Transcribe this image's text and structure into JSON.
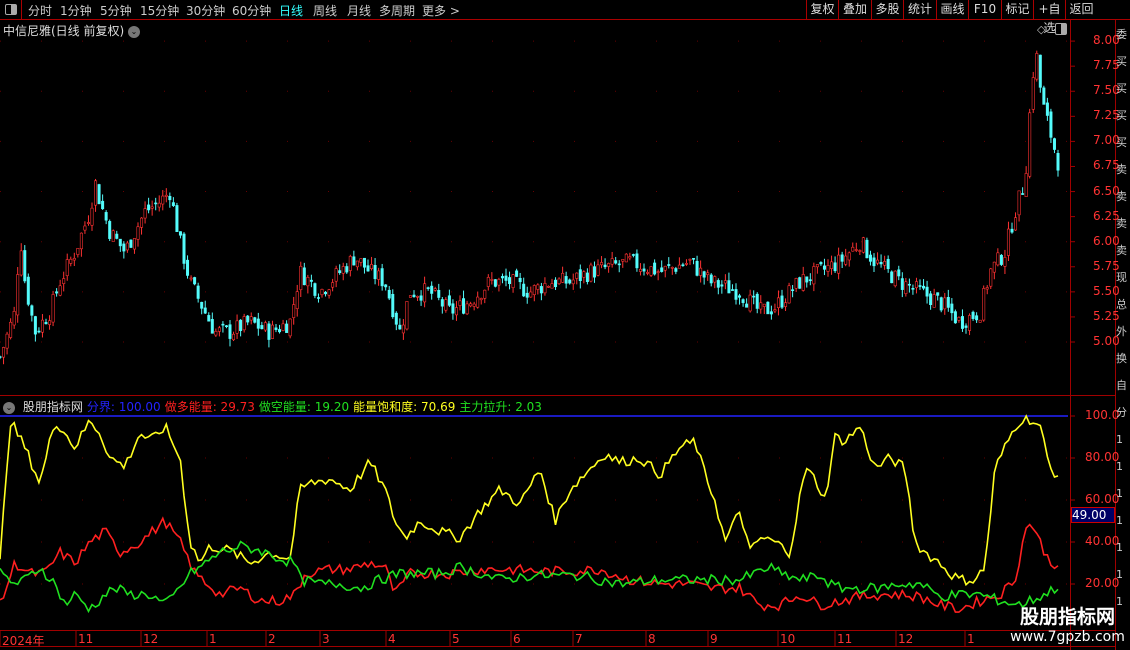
{
  "toolbar": {
    "periods": [
      "分时",
      "1分钟",
      "5分钟",
      "15分钟",
      "30分钟",
      "60分钟",
      "日线",
      "周线",
      "月线",
      "多周期",
      "更多 >"
    ],
    "active": "日线",
    "right_buttons": [
      "复权",
      "叠加",
      "多股",
      "统计",
      "画线",
      "F10",
      "标记",
      "+自选",
      "返回"
    ]
  },
  "chart_title": "中信尼雅(日线 前复权)",
  "indicator": {
    "name": "股朋指标网",
    "items": [
      {
        "label": "分界: 100.00",
        "color": "#2323ff"
      },
      {
        "label": "做多能量: 29.73",
        "color": "#ff2020"
      },
      {
        "label": "做空能量: 19.20",
        "color": "#20e020"
      },
      {
        "label": "能量饱和度: 70.69",
        "color": "#ffff20"
      },
      {
        "label": "主力拉升: 2.03",
        "color": "#20e020"
      }
    ],
    "cursor_value": "49.00"
  },
  "price_axis": [
    "8.00",
    "7.75",
    "7.50",
    "7.25",
    "7.00",
    "6.75",
    "6.50",
    "6.25",
    "6.00",
    "5.75",
    "5.50",
    "5.25",
    "5.00"
  ],
  "ind_axis": [
    "100.0",
    "80.00",
    "60.00",
    "40.00",
    "20.00"
  ],
  "date_axis": [
    "2024年",
    "11",
    "12",
    "1",
    "2",
    "3",
    "4",
    "5",
    "6",
    "7",
    "8",
    "9",
    "10",
    "11",
    "12",
    "1"
  ],
  "watermark": {
    "line1": "股朋指标网",
    "line2": "www.7gpzb.com"
  },
  "right_column_text": [
    "委",
    "买",
    "买",
    "买",
    "买",
    "卖",
    "卖",
    "卖",
    "卖",
    "现",
    "总",
    "外",
    "换",
    "自",
    "分",
    "1",
    "1",
    "1",
    "1",
    "1",
    "1",
    "1"
  ],
  "colors": {
    "up": "#ff3232",
    "down": "#54fcfc",
    "grid": "#a00000",
    "boundary": "#2323ff",
    "long": "#ff2020",
    "short": "#20e020",
    "saturation": "#ffff20"
  },
  "chart_data": {
    "type": "line",
    "t_range": [
      0,
      212
    ],
    "price": [
      [
        0,
        4.85
      ],
      [
        3,
        5.3
      ],
      [
        4,
        6.1
      ],
      [
        5,
        5.6
      ],
      [
        7,
        5.1
      ],
      [
        10,
        5.3
      ],
      [
        12,
        5.6
      ],
      [
        15,
        5.9
      ],
      [
        18,
        6.3
      ],
      [
        19,
        6.6
      ],
      [
        20,
        6.4
      ],
      [
        22,
        6.1
      ],
      [
        25,
        5.9
      ],
      [
        27,
        6.1
      ],
      [
        29,
        6.3
      ],
      [
        32,
        6.4
      ],
      [
        34,
        6.5
      ],
      [
        36,
        6.0
      ],
      [
        38,
        5.6
      ],
      [
        40,
        5.4
      ],
      [
        43,
        5.1
      ],
      [
        46,
        5.1
      ],
      [
        50,
        5.2
      ],
      [
        54,
        5.1
      ],
      [
        58,
        5.2
      ],
      [
        60,
        5.7
      ],
      [
        64,
        5.5
      ],
      [
        68,
        5.7
      ],
      [
        71,
        5.85
      ],
      [
        74,
        5.7
      ],
      [
        77,
        5.6
      ],
      [
        80,
        5.1
      ],
      [
        82,
        5.5
      ],
      [
        86,
        5.5
      ],
      [
        90,
        5.3
      ],
      [
        94,
        5.4
      ],
      [
        98,
        5.6
      ],
      [
        102,
        5.6
      ],
      [
        106,
        5.5
      ],
      [
        110,
        5.6
      ],
      [
        114,
        5.6
      ],
      [
        118,
        5.7
      ],
      [
        122,
        5.75
      ],
      [
        126,
        5.8
      ],
      [
        132,
        5.7
      ],
      [
        138,
        5.8
      ],
      [
        142,
        5.6
      ],
      [
        148,
        5.5
      ],
      [
        152,
        5.3
      ],
      [
        155,
        5.35
      ],
      [
        160,
        5.6
      ],
      [
        164,
        5.7
      ],
      [
        168,
        5.8
      ],
      [
        172,
        6.0
      ],
      [
        175,
        5.8
      ],
      [
        180,
        5.6
      ],
      [
        184,
        5.5
      ],
      [
        188,
        5.4
      ],
      [
        192,
        5.2
      ],
      [
        196,
        5.3
      ],
      [
        198,
        5.7
      ],
      [
        201,
        5.9
      ],
      [
        203,
        6.3
      ],
      [
        205,
        6.6
      ],
      [
        206.4,
        7.6
      ],
      [
        207.2,
        7.9
      ],
      [
        208.4,
        7.4
      ],
      [
        210,
        7.1
      ],
      [
        211.6,
        6.8
      ]
    ],
    "series": [
      {
        "name": "能量饱和度",
        "values": [
          [
            0,
            30
          ],
          [
            2,
            98
          ],
          [
            5,
            85
          ],
          [
            8,
            68
          ],
          [
            11,
            98
          ],
          [
            13,
            92
          ],
          [
            15,
            85
          ],
          [
            18,
            98
          ],
          [
            20,
            92
          ],
          [
            22,
            80
          ],
          [
            25,
            76
          ],
          [
            28,
            92
          ],
          [
            30,
            88
          ],
          [
            33,
            95
          ],
          [
            36,
            80
          ],
          [
            38,
            40
          ],
          [
            40,
            30
          ],
          [
            42,
            38
          ],
          [
            46,
            36
          ],
          [
            50,
            30
          ],
          [
            54,
            35
          ],
          [
            58,
            32
          ],
          [
            60,
            65
          ],
          [
            62,
            68
          ],
          [
            66,
            70
          ],
          [
            70,
            65
          ],
          [
            74,
            78
          ],
          [
            77,
            65
          ],
          [
            79,
            50
          ],
          [
            81,
            42
          ],
          [
            84,
            50
          ],
          [
            88,
            45
          ],
          [
            92,
            42
          ],
          [
            96,
            55
          ],
          [
            100,
            65
          ],
          [
            104,
            58
          ],
          [
            108,
            75
          ],
          [
            111,
            50
          ],
          [
            114,
            65
          ],
          [
            118,
            75
          ],
          [
            121,
            82
          ],
          [
            124,
            78
          ],
          [
            128,
            80
          ],
          [
            132,
            72
          ],
          [
            136,
            85
          ],
          [
            139,
            88
          ],
          [
            141,
            72
          ],
          [
            143,
            60
          ],
          [
            145,
            40
          ],
          [
            148,
            55
          ],
          [
            150,
            35
          ],
          [
            152,
            42
          ],
          [
            155,
            40
          ],
          [
            158,
            35
          ],
          [
            161,
            75
          ],
          [
            163,
            70
          ],
          [
            165,
            60
          ],
          [
            167,
            90
          ],
          [
            169,
            88
          ],
          [
            172,
            95
          ],
          [
            175,
            75
          ],
          [
            178,
            80
          ],
          [
            181,
            75
          ],
          [
            183,
            40
          ],
          [
            185,
            35
          ],
          [
            188,
            30
          ],
          [
            190,
            25
          ],
          [
            192,
            22
          ],
          [
            195,
            22
          ],
          [
            197,
            28
          ],
          [
            199,
            75
          ],
          [
            201,
            85
          ],
          [
            203,
            95
          ],
          [
            205,
            100
          ],
          [
            208,
            95
          ],
          [
            210,
            75
          ],
          [
            211.6,
            72
          ]
        ]
      },
      {
        "name": "做多能量",
        "values": [
          [
            0,
            10
          ],
          [
            3,
            30
          ],
          [
            6,
            25
          ],
          [
            9,
            25
          ],
          [
            12,
            35
          ],
          [
            15,
            30
          ],
          [
            18,
            40
          ],
          [
            21,
            45
          ],
          [
            24,
            35
          ],
          [
            28,
            40
          ],
          [
            33,
            50
          ],
          [
            36,
            40
          ],
          [
            39,
            25
          ],
          [
            44,
            15
          ],
          [
            48,
            18
          ],
          [
            52,
            12
          ],
          [
            56,
            12
          ],
          [
            59,
            15
          ],
          [
            61,
            25
          ],
          [
            66,
            27
          ],
          [
            70,
            27
          ],
          [
            74,
            30
          ],
          [
            77,
            28
          ],
          [
            79,
            15
          ],
          [
            82,
            25
          ],
          [
            86,
            25
          ],
          [
            90,
            25
          ],
          [
            96,
            27
          ],
          [
            102,
            27
          ],
          [
            108,
            26
          ],
          [
            114,
            26
          ],
          [
            120,
            27
          ],
          [
            126,
            22
          ],
          [
            132,
            20
          ],
          [
            138,
            20
          ],
          [
            142,
            18
          ],
          [
            148,
            18
          ],
          [
            152,
            10
          ],
          [
            156,
            10
          ],
          [
            160,
            15
          ],
          [
            164,
            10
          ],
          [
            168,
            12
          ],
          [
            172,
            14
          ],
          [
            176,
            15
          ],
          [
            180,
            15
          ],
          [
            184,
            14
          ],
          [
            188,
            10
          ],
          [
            192,
            8
          ],
          [
            196,
            12
          ],
          [
            200,
            15
          ],
          [
            203,
            22
          ],
          [
            205,
            45
          ],
          [
            206,
            50
          ],
          [
            208,
            40
          ],
          [
            210,
            30
          ],
          [
            211.6,
            29.73
          ]
        ]
      },
      {
        "name": "做空能量",
        "values": [
          [
            0,
            25
          ],
          [
            3,
            20
          ],
          [
            5,
            22
          ],
          [
            8,
            28
          ],
          [
            11,
            20
          ],
          [
            13,
            10
          ],
          [
            15,
            15
          ],
          [
            18,
            8
          ],
          [
            21,
            15
          ],
          [
            23,
            18
          ],
          [
            26,
            15
          ],
          [
            30,
            15
          ],
          [
            33,
            10
          ],
          [
            35,
            15
          ],
          [
            38,
            25
          ],
          [
            40,
            28
          ],
          [
            44,
            35
          ],
          [
            48,
            38
          ],
          [
            52,
            36
          ],
          [
            56,
            32
          ],
          [
            59,
            30
          ],
          [
            60,
            22
          ],
          [
            64,
            20
          ],
          [
            68,
            20
          ],
          [
            72,
            18
          ],
          [
            76,
            22
          ],
          [
            80,
            25
          ],
          [
            84,
            25
          ],
          [
            88,
            25
          ],
          [
            92,
            28
          ],
          [
            96,
            25
          ],
          [
            100,
            22
          ],
          [
            106,
            24
          ],
          [
            112,
            24
          ],
          [
            116,
            24
          ],
          [
            120,
            22
          ],
          [
            124,
            20
          ],
          [
            128,
            21
          ],
          [
            132,
            22
          ],
          [
            136,
            22
          ],
          [
            140,
            22
          ],
          [
            144,
            22
          ],
          [
            148,
            22
          ],
          [
            152,
            26
          ],
          [
            154,
            28
          ],
          [
            156,
            25
          ],
          [
            160,
            22
          ],
          [
            164,
            24
          ],
          [
            166,
            20
          ],
          [
            168,
            18
          ],
          [
            172,
            18
          ],
          [
            176,
            18
          ],
          [
            180,
            20
          ],
          [
            184,
            20
          ],
          [
            188,
            14
          ],
          [
            192,
            15
          ],
          [
            196,
            15
          ],
          [
            200,
            12
          ],
          [
            204,
            10
          ],
          [
            206,
            12
          ],
          [
            209,
            15
          ],
          [
            211,
            18
          ],
          [
            211.6,
            19.2
          ]
        ]
      }
    ]
  }
}
